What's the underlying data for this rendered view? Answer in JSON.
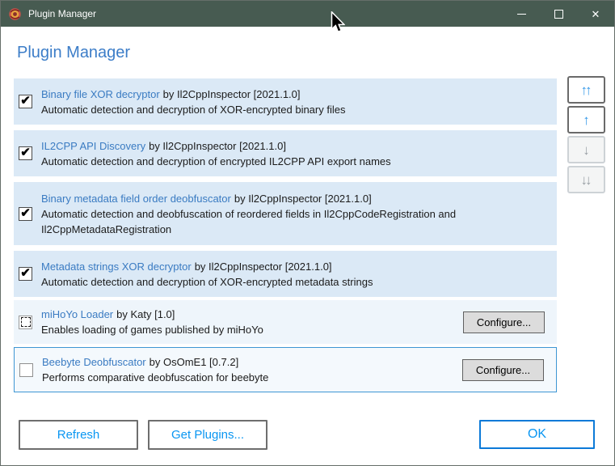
{
  "window": {
    "title": "Plugin Manager"
  },
  "header": {
    "title": "Plugin Manager"
  },
  "icons": {
    "check": "✔",
    "close": "✕",
    "app_icon": "rose-logo"
  },
  "labels": {
    "configure": "Configure..."
  },
  "plugins": [
    {
      "name": "Binary file XOR decryptor",
      "byline": "by Il2CppInspector [2021.1.0]",
      "description": "Automatic detection and decryption of XOR-encrypted binary files",
      "checkbox": "checked",
      "selected": false,
      "configure": false
    },
    {
      "name": "IL2CPP API Discovery",
      "byline": "by Il2CppInspector [2021.1.0]",
      "description": "Automatic detection and decryption of encrypted IL2CPP API export names",
      "checkbox": "checked",
      "selected": false,
      "configure": false
    },
    {
      "name": "Binary metadata field order deobfuscator",
      "byline": "by Il2CppInspector [2021.1.0]",
      "description": "Automatic detection and deobfuscation of reordered fields in Il2CppCodeRegistration and Il2CppMetadataRegistration",
      "checkbox": "checked",
      "selected": false,
      "configure": false
    },
    {
      "name": "Metadata strings XOR decryptor",
      "byline": "by Il2CppInspector [2021.1.0]",
      "description": "Automatic detection and decryption of XOR-encrypted metadata strings",
      "checkbox": "checked",
      "selected": false,
      "configure": false
    },
    {
      "name": "miHoYo Loader",
      "byline": "by Katy [1.0]",
      "description": "Enables loading of games published by miHoYo",
      "checkbox": "indeterminate",
      "selected": false,
      "configure": true
    },
    {
      "name": "Beebyte Deobfuscator",
      "byline": "by OsOmE1 [0.7.2]",
      "description": "Performs comparative deobfuscation for beebyte",
      "checkbox": "unchecked",
      "selected": true,
      "configure": true
    }
  ],
  "reorder_buttons": [
    {
      "id": "move-to-top",
      "glyph": "↑↑",
      "enabled": true
    },
    {
      "id": "move-up",
      "glyph": "↑",
      "enabled": true
    },
    {
      "id": "move-down",
      "glyph": "↓",
      "enabled": false
    },
    {
      "id": "move-to-bottom",
      "glyph": "↓↓",
      "enabled": false
    }
  ],
  "footer": {
    "refresh": "Refresh",
    "get_plugins": "Get Plugins...",
    "ok": "OK"
  },
  "colors": {
    "titlebar": "#475b51",
    "heading": "#3c7dc8",
    "link": "#3a7bc2",
    "row_enabled_bg": "#dbe9f6",
    "row_loader_bg": "#eef5fb",
    "row_selected_bg": "#f4f9fd",
    "selected_border": "#3e96d3",
    "button_text": "#0996f2",
    "ok_border": "#0c7ad8",
    "arrow_enabled": "#3498e8",
    "arrow_disabled": "#9aa0a5"
  }
}
